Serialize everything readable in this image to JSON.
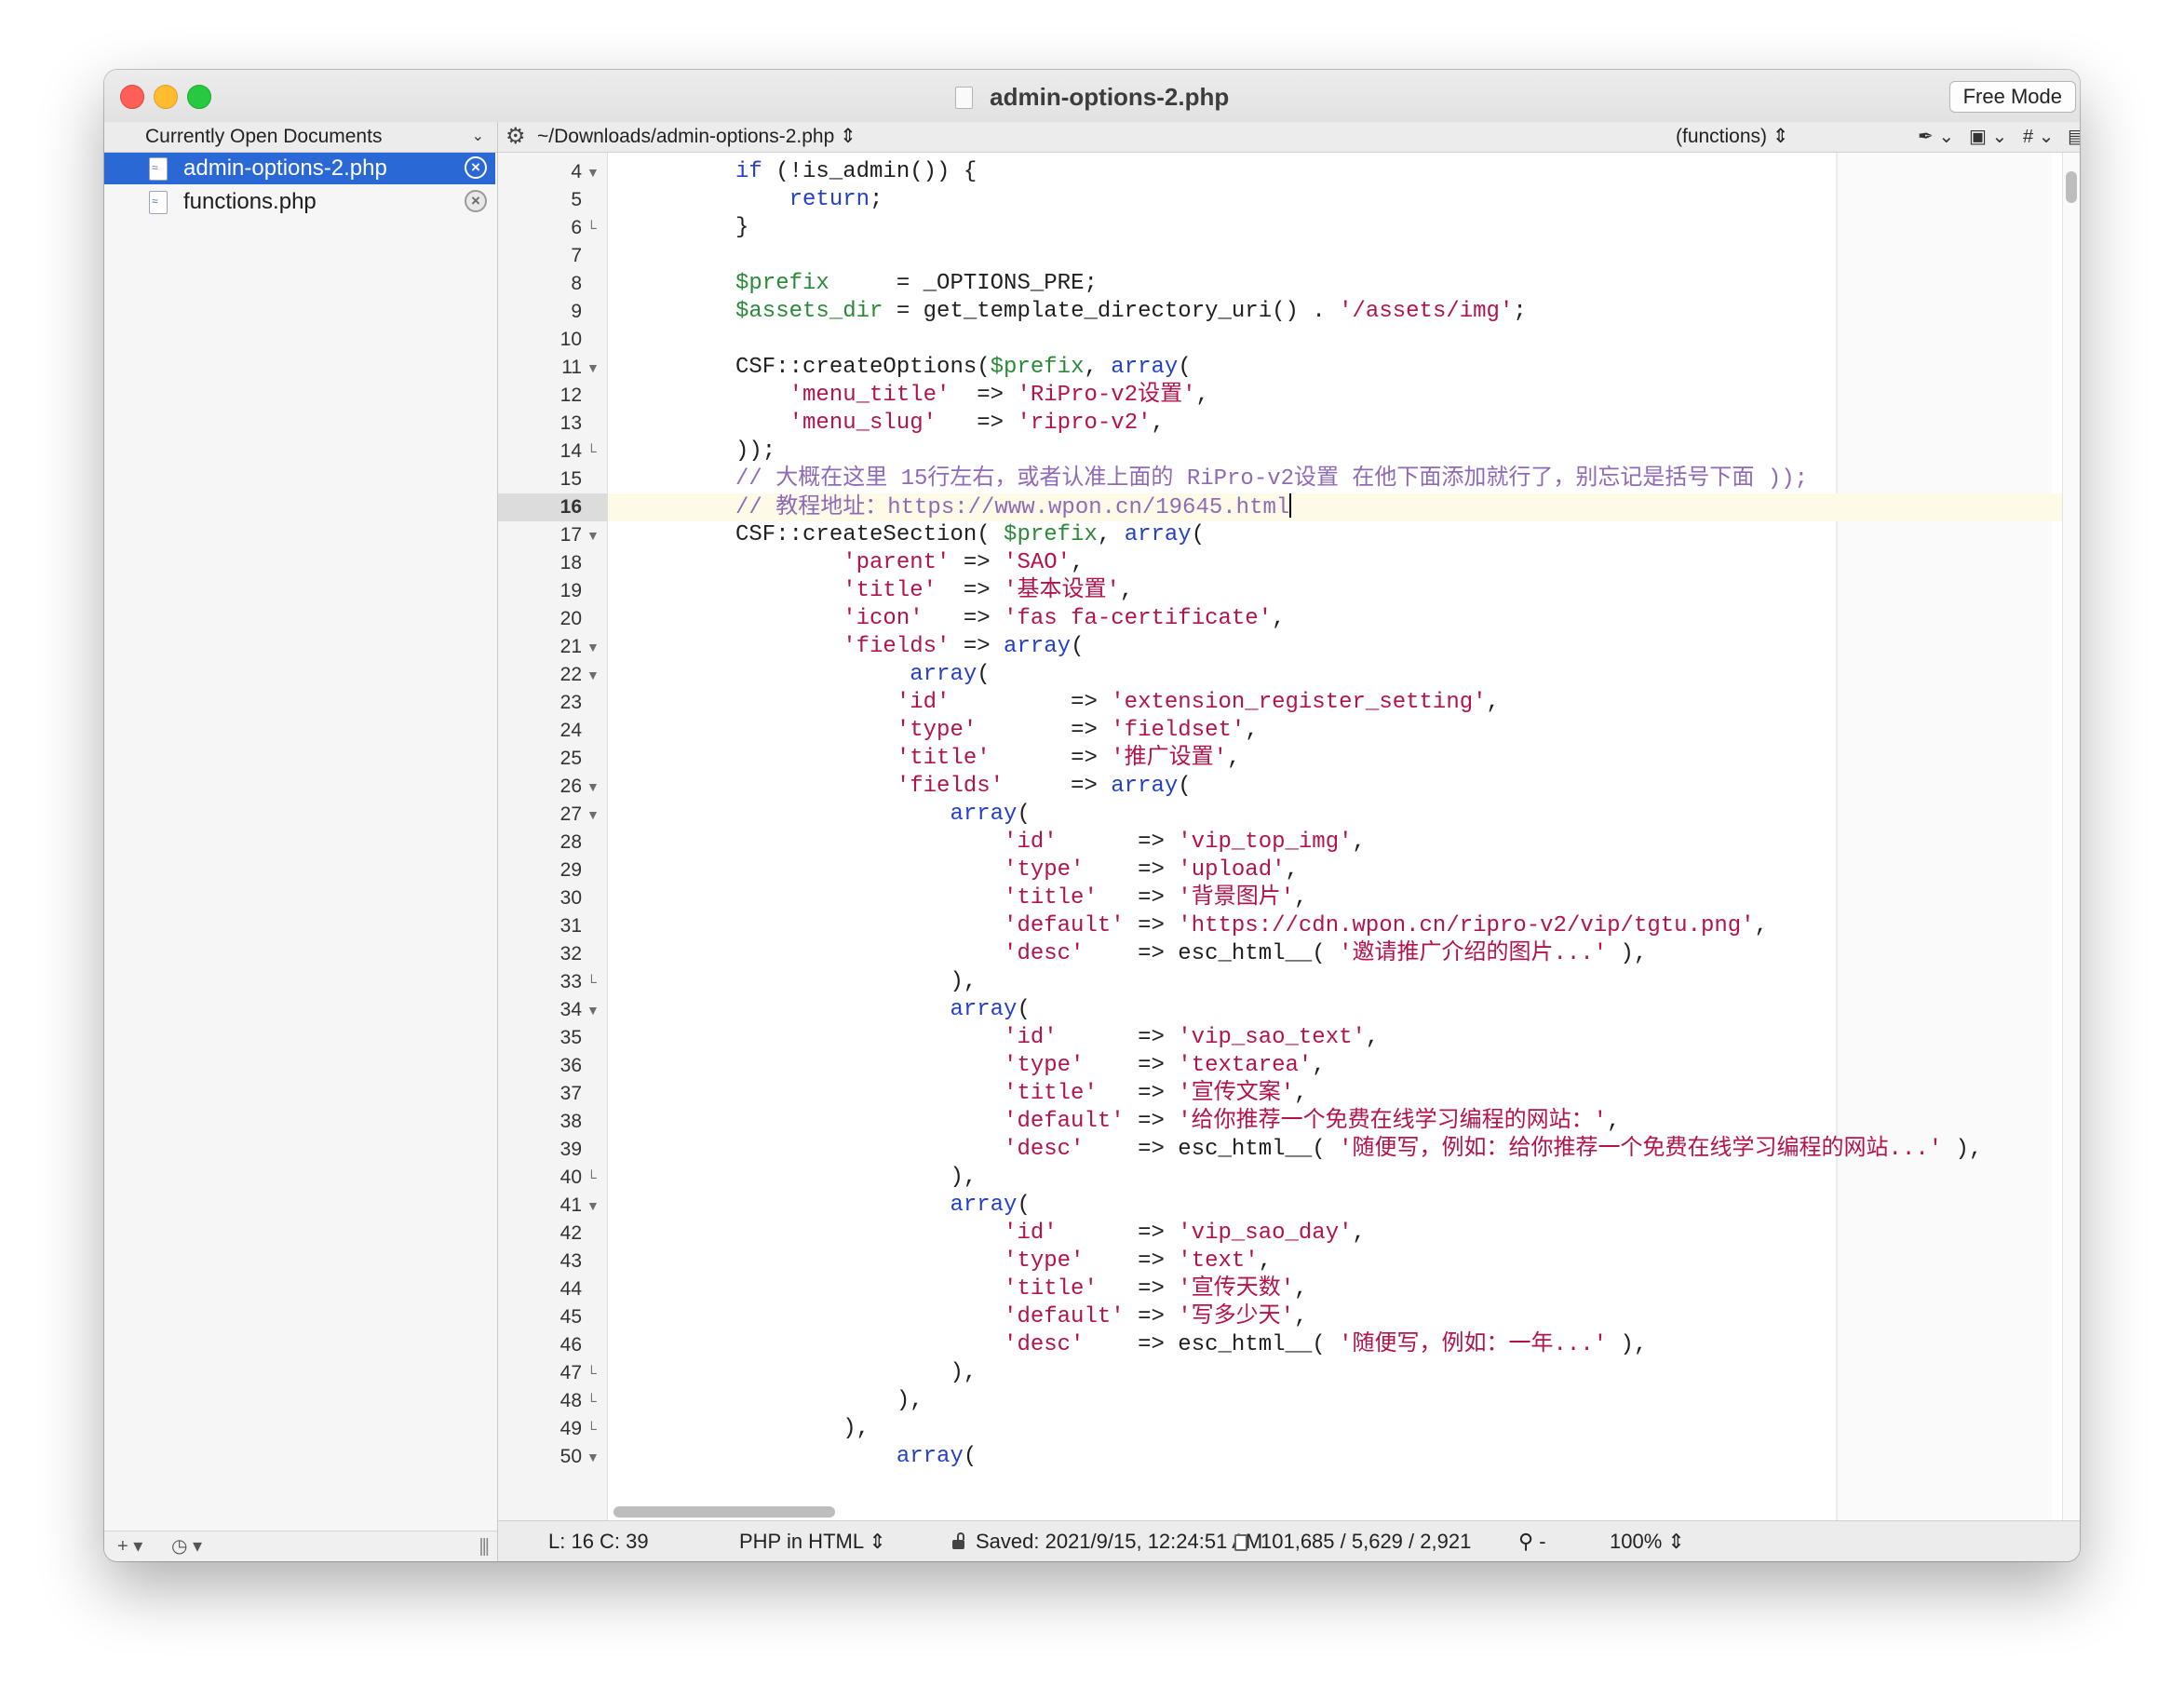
{
  "window": {
    "title": "admin-options-2.php",
    "free_mode_label": "Free Mode"
  },
  "sidebar": {
    "header": "Currently Open Documents",
    "documents": [
      {
        "name": "admin-options-2.php",
        "selected": true
      },
      {
        "name": "functions.php",
        "selected": false
      }
    ],
    "footer": {
      "add_label": "+",
      "history_label": "◷"
    }
  },
  "navbar": {
    "path": "~/Downloads/admin-options-2.php",
    "function_popup": "(functions)",
    "icons": [
      "gear-icon",
      "pen-icon",
      "documents-icon",
      "hash-icon",
      "page-icon"
    ]
  },
  "editor": {
    "current_line": 16,
    "lines": [
      {
        "n": 4,
        "fold": "open",
        "tokens": [
          [
            "kw",
            "if"
          ],
          [
            "pl",
            " (!is_admin()) {"
          ]
        ]
      },
      {
        "n": 5,
        "fold": "",
        "tokens": [
          [
            "pl",
            "    "
          ],
          [
            "kw",
            "return"
          ],
          [
            "pl",
            ";"
          ]
        ]
      },
      {
        "n": 6,
        "fold": "close",
        "tokens": [
          [
            "pl",
            "}"
          ]
        ]
      },
      {
        "n": 7,
        "fold": "",
        "tokens": []
      },
      {
        "n": 8,
        "fold": "",
        "tokens": [
          [
            "var",
            "$prefix"
          ],
          [
            "pl",
            "     = _OPTIONS_PRE;"
          ]
        ]
      },
      {
        "n": 9,
        "fold": "",
        "tokens": [
          [
            "var",
            "$assets_dir"
          ],
          [
            "pl",
            " = get_template_directory_uri() . "
          ],
          [
            "str",
            "'/assets/img'"
          ],
          [
            "pl",
            ";"
          ]
        ]
      },
      {
        "n": 10,
        "fold": "",
        "tokens": []
      },
      {
        "n": 11,
        "fold": "open",
        "tokens": [
          [
            "pl",
            "CSF::createOptions("
          ],
          [
            "var",
            "$prefix"
          ],
          [
            "pl",
            ", "
          ],
          [
            "kw",
            "array"
          ],
          [
            "pl",
            "("
          ]
        ]
      },
      {
        "n": 12,
        "fold": "",
        "tokens": [
          [
            "pl",
            "    "
          ],
          [
            "str",
            "'menu_title'"
          ],
          [
            "pl",
            "  => "
          ],
          [
            "str",
            "'RiPro-v2设置'"
          ],
          [
            "pl",
            ","
          ]
        ]
      },
      {
        "n": 13,
        "fold": "",
        "tokens": [
          [
            "pl",
            "    "
          ],
          [
            "str",
            "'menu_slug'"
          ],
          [
            "pl",
            "   => "
          ],
          [
            "str",
            "'ripro-v2'"
          ],
          [
            "pl",
            ","
          ]
        ]
      },
      {
        "n": 14,
        "fold": "close",
        "tokens": [
          [
            "pl",
            "));"
          ]
        ]
      },
      {
        "n": 15,
        "fold": "",
        "tokens": [
          [
            "com",
            "// 大概在这里 15行左右，或者认准上面的 RiPro-v2设置 在他下面添加就行了，别忘记是括号下面 ));"
          ]
        ]
      },
      {
        "n": 16,
        "fold": "",
        "tokens": [
          [
            "com",
            "// 教程地址：https://www.wpon.cn/19645.html"
          ]
        ],
        "caret": true
      },
      {
        "n": 17,
        "fold": "open",
        "tokens": [
          [
            "pl",
            "CSF::createSection( "
          ],
          [
            "var",
            "$prefix"
          ],
          [
            "pl",
            ", "
          ],
          [
            "kw",
            "array"
          ],
          [
            "pl",
            "("
          ]
        ]
      },
      {
        "n": 18,
        "fold": "",
        "tokens": [
          [
            "pl",
            "        "
          ],
          [
            "str",
            "'parent'"
          ],
          [
            "pl",
            " => "
          ],
          [
            "str",
            "'SAO'"
          ],
          [
            "pl",
            ","
          ]
        ]
      },
      {
        "n": 19,
        "fold": "",
        "tokens": [
          [
            "pl",
            "        "
          ],
          [
            "str",
            "'title'"
          ],
          [
            "pl",
            "  => "
          ],
          [
            "str",
            "'基本设置'"
          ],
          [
            "pl",
            ","
          ]
        ]
      },
      {
        "n": 20,
        "fold": "",
        "tokens": [
          [
            "pl",
            "        "
          ],
          [
            "str",
            "'icon'"
          ],
          [
            "pl",
            "   => "
          ],
          [
            "str",
            "'fas fa-certificate'"
          ],
          [
            "pl",
            ","
          ]
        ]
      },
      {
        "n": 21,
        "fold": "open",
        "tokens": [
          [
            "pl",
            "        "
          ],
          [
            "str",
            "'fields'"
          ],
          [
            "pl",
            " => "
          ],
          [
            "kw",
            "array"
          ],
          [
            "pl",
            "("
          ]
        ]
      },
      {
        "n": 22,
        "fold": "open",
        "tokens": [
          [
            "pl",
            "             "
          ],
          [
            "kw",
            "array"
          ],
          [
            "pl",
            "("
          ]
        ]
      },
      {
        "n": 23,
        "fold": "",
        "tokens": [
          [
            "pl",
            "            "
          ],
          [
            "str",
            "'id'"
          ],
          [
            "pl",
            "         => "
          ],
          [
            "str",
            "'extension_register_setting'"
          ],
          [
            "pl",
            ","
          ]
        ]
      },
      {
        "n": 24,
        "fold": "",
        "tokens": [
          [
            "pl",
            "            "
          ],
          [
            "str",
            "'type'"
          ],
          [
            "pl",
            "       => "
          ],
          [
            "str",
            "'fieldset'"
          ],
          [
            "pl",
            ","
          ]
        ]
      },
      {
        "n": 25,
        "fold": "",
        "tokens": [
          [
            "pl",
            "            "
          ],
          [
            "str",
            "'title'"
          ],
          [
            "pl",
            "      => "
          ],
          [
            "str",
            "'推广设置'"
          ],
          [
            "pl",
            ","
          ]
        ]
      },
      {
        "n": 26,
        "fold": "open",
        "tokens": [
          [
            "pl",
            "            "
          ],
          [
            "str",
            "'fields'"
          ],
          [
            "pl",
            "     => "
          ],
          [
            "kw",
            "array"
          ],
          [
            "pl",
            "("
          ]
        ]
      },
      {
        "n": 27,
        "fold": "open",
        "tokens": [
          [
            "pl",
            "                "
          ],
          [
            "kw",
            "array"
          ],
          [
            "pl",
            "("
          ]
        ]
      },
      {
        "n": 28,
        "fold": "",
        "tokens": [
          [
            "pl",
            "                    "
          ],
          [
            "str",
            "'id'"
          ],
          [
            "pl",
            "      => "
          ],
          [
            "str",
            "'vip_top_img'"
          ],
          [
            "pl",
            ","
          ]
        ]
      },
      {
        "n": 29,
        "fold": "",
        "tokens": [
          [
            "pl",
            "                    "
          ],
          [
            "str",
            "'type'"
          ],
          [
            "pl",
            "    => "
          ],
          [
            "str",
            "'upload'"
          ],
          [
            "pl",
            ","
          ]
        ]
      },
      {
        "n": 30,
        "fold": "",
        "tokens": [
          [
            "pl",
            "                    "
          ],
          [
            "str",
            "'title'"
          ],
          [
            "pl",
            "   => "
          ],
          [
            "str",
            "'背景图片'"
          ],
          [
            "pl",
            ","
          ]
        ]
      },
      {
        "n": 31,
        "fold": "",
        "tokens": [
          [
            "pl",
            "                    "
          ],
          [
            "str",
            "'default'"
          ],
          [
            "pl",
            " => "
          ],
          [
            "str",
            "'https://cdn.wpon.cn/ripro-v2/vip/tgtu.png'"
          ],
          [
            "pl",
            ","
          ]
        ]
      },
      {
        "n": 32,
        "fold": "",
        "tokens": [
          [
            "pl",
            "                    "
          ],
          [
            "str",
            "'desc'"
          ],
          [
            "pl",
            "    => esc_html__( "
          ],
          [
            "str",
            "'邀请推广介绍的图片...'"
          ],
          [
            "pl",
            " ),"
          ]
        ]
      },
      {
        "n": 33,
        "fold": "close",
        "tokens": [
          [
            "pl",
            "                ),"
          ]
        ]
      },
      {
        "n": 34,
        "fold": "open",
        "tokens": [
          [
            "pl",
            "                "
          ],
          [
            "kw",
            "array"
          ],
          [
            "pl",
            "("
          ]
        ]
      },
      {
        "n": 35,
        "fold": "",
        "tokens": [
          [
            "pl",
            "                    "
          ],
          [
            "str",
            "'id'"
          ],
          [
            "pl",
            "      => "
          ],
          [
            "str",
            "'vip_sao_text'"
          ],
          [
            "pl",
            ","
          ]
        ]
      },
      {
        "n": 36,
        "fold": "",
        "tokens": [
          [
            "pl",
            "                    "
          ],
          [
            "str",
            "'type'"
          ],
          [
            "pl",
            "    => "
          ],
          [
            "str",
            "'textarea'"
          ],
          [
            "pl",
            ","
          ]
        ]
      },
      {
        "n": 37,
        "fold": "",
        "tokens": [
          [
            "pl",
            "                    "
          ],
          [
            "str",
            "'title'"
          ],
          [
            "pl",
            "   => "
          ],
          [
            "str",
            "'宣传文案'"
          ],
          [
            "pl",
            ","
          ]
        ]
      },
      {
        "n": 38,
        "fold": "",
        "tokens": [
          [
            "pl",
            "                    "
          ],
          [
            "str",
            "'default'"
          ],
          [
            "pl",
            " => "
          ],
          [
            "str",
            "'给你推荐一个免费在线学习编程的网站：'"
          ],
          [
            "pl",
            ","
          ]
        ]
      },
      {
        "n": 39,
        "fold": "",
        "tokens": [
          [
            "pl",
            "                    "
          ],
          [
            "str",
            "'desc'"
          ],
          [
            "pl",
            "    => esc_html__( "
          ],
          [
            "str",
            "'随便写，例如：给你推荐一个免费在线学习编程的网站...'"
          ],
          [
            "pl",
            " ),"
          ]
        ]
      },
      {
        "n": 40,
        "fold": "close",
        "tokens": [
          [
            "pl",
            "                ),"
          ]
        ]
      },
      {
        "n": 41,
        "fold": "open",
        "tokens": [
          [
            "pl",
            "                "
          ],
          [
            "kw",
            "array"
          ],
          [
            "pl",
            "("
          ]
        ]
      },
      {
        "n": 42,
        "fold": "",
        "tokens": [
          [
            "pl",
            "                    "
          ],
          [
            "str",
            "'id'"
          ],
          [
            "pl",
            "      => "
          ],
          [
            "str",
            "'vip_sao_day'"
          ],
          [
            "pl",
            ","
          ]
        ]
      },
      {
        "n": 43,
        "fold": "",
        "tokens": [
          [
            "pl",
            "                    "
          ],
          [
            "str",
            "'type'"
          ],
          [
            "pl",
            "    => "
          ],
          [
            "str",
            "'text'"
          ],
          [
            "pl",
            ","
          ]
        ]
      },
      {
        "n": 44,
        "fold": "",
        "tokens": [
          [
            "pl",
            "                    "
          ],
          [
            "str",
            "'title'"
          ],
          [
            "pl",
            "   => "
          ],
          [
            "str",
            "'宣传天数'"
          ],
          [
            "pl",
            ","
          ]
        ]
      },
      {
        "n": 45,
        "fold": "",
        "tokens": [
          [
            "pl",
            "                    "
          ],
          [
            "str",
            "'default'"
          ],
          [
            "pl",
            " => "
          ],
          [
            "str",
            "'写多少天'"
          ],
          [
            "pl",
            ","
          ]
        ]
      },
      {
        "n": 46,
        "fold": "",
        "tokens": [
          [
            "pl",
            "                    "
          ],
          [
            "str",
            "'desc'"
          ],
          [
            "pl",
            "    => esc_html__( "
          ],
          [
            "str",
            "'随便写，例如：一年...'"
          ],
          [
            "pl",
            " ),"
          ]
        ]
      },
      {
        "n": 47,
        "fold": "close",
        "tokens": [
          [
            "pl",
            "                ),"
          ]
        ]
      },
      {
        "n": 48,
        "fold": "close",
        "tokens": [
          [
            "pl",
            "            ),"
          ]
        ]
      },
      {
        "n": 49,
        "fold": "close",
        "tokens": [
          [
            "pl",
            "        ),"
          ]
        ]
      },
      {
        "n": 50,
        "fold": "open",
        "tokens": [
          [
            "pl",
            "            "
          ],
          [
            "kw",
            "array"
          ],
          [
            "pl",
            "("
          ]
        ]
      }
    ]
  },
  "statusbar": {
    "cursor": "L: 16 C: 39",
    "language": "PHP in HTML",
    "saved": "Saved: 2021/9/15, 12:24:51 AM",
    "counts": "101,685 / 5,629 / 2,921",
    "zoom_minus": "-",
    "zoom": "100%"
  },
  "colors": {
    "keyword": "#2440c8",
    "variable": "#2b8a3a",
    "string": "#b3134c",
    "comment": "#8f6ab7",
    "selection": "#2a68d6",
    "current_line": "#fdfbe8"
  }
}
